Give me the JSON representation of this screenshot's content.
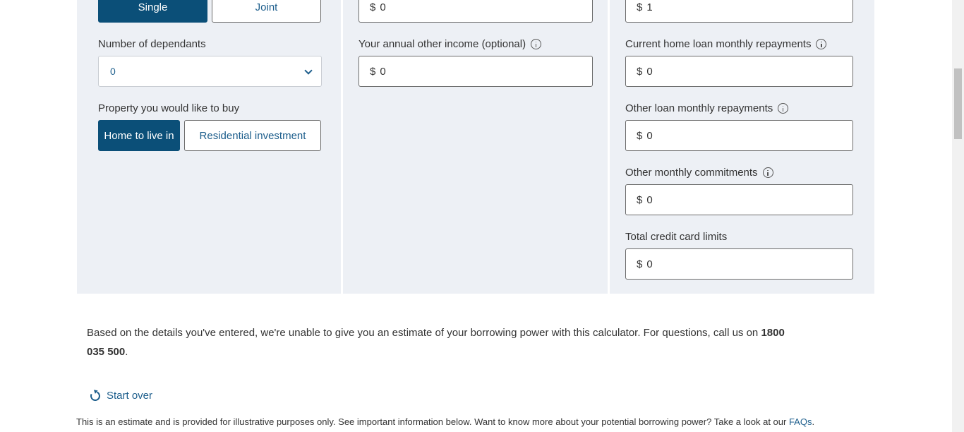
{
  "applicant_type": {
    "single_label": "Single",
    "joint_label": "Joint"
  },
  "dependants": {
    "label": "Number of dependants",
    "value": "0"
  },
  "property": {
    "label": "Property you would like to buy",
    "home_label": "Home to live in",
    "investment_label": "Residential investment"
  },
  "income": {
    "top_currency": "$",
    "top_value": "0",
    "other_label": "Your annual other income (optional)",
    "other_currency": "$",
    "other_value": "0"
  },
  "expenses": {
    "top_currency": "$",
    "top_value": "1",
    "home_loan_label": "Current home loan monthly repayments",
    "home_loan_currency": "$",
    "home_loan_value": "0",
    "other_loan_label": "Other loan monthly repayments",
    "other_loan_currency": "$",
    "other_loan_value": "0",
    "commitments_label": "Other monthly commitments",
    "commitments_currency": "$",
    "commitments_value": "0",
    "credit_label": "Total credit card limits",
    "credit_currency": "$",
    "credit_value": "0"
  },
  "result": {
    "text": "Based on the details you've entered, we're unable to give you an estimate of your borrowing power with this calculator. For questions, call us on ",
    "phone": "1800 035 500",
    "end": "."
  },
  "start_over_label": "Start over",
  "disclaimer": {
    "text": "This is an estimate and is provided for illustrative purposes only. See important information below. Want to know more about your potential borrowing power? Take a look at our ",
    "link": "FAQs",
    "end": "."
  },
  "colors": {
    "primary": "#0b4f78",
    "link": "#1d5e8c",
    "panel": "#edf0f5"
  },
  "icons": {
    "info": "info-icon",
    "chevron": "chevron-down-icon",
    "reload": "reload-icon"
  }
}
